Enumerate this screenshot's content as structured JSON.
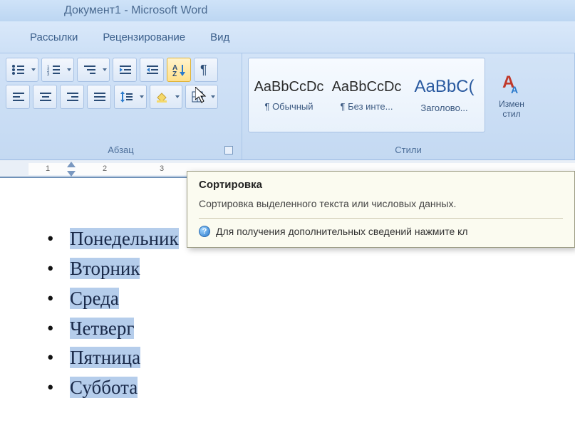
{
  "title": "Документ1 - Microsoft Word",
  "tabs": {
    "mailings": "Рассылки",
    "review": "Рецензирование",
    "view": "Вид"
  },
  "paragraph": {
    "label": "Абзац",
    "buttons": {
      "bullets": "bullets",
      "numbering": "numbering",
      "multilevel": "multilevel",
      "dec_indent": "decrease-indent",
      "inc_indent": "increase-indent",
      "sort": "sort",
      "marks": "show-marks",
      "align_left": "align-left",
      "align_center": "align-center",
      "align_right": "align-right",
      "justify": "justify",
      "line_spacing": "line-spacing",
      "shading": "shading",
      "borders": "borders"
    }
  },
  "styles": {
    "label": "Стили",
    "change_label_1": "Измен",
    "change_label_2": "стил",
    "items": [
      {
        "preview": "AaBbCcDc",
        "name": "¶ Обычный"
      },
      {
        "preview": "AaBbCcDc",
        "name": "¶ Без инте..."
      },
      {
        "preview": "AaBbC(",
        "name": "Заголово..."
      }
    ]
  },
  "tooltip": {
    "title": "Сортировка",
    "body": "Сортировка выделенного текста или числовых данных.",
    "help": "Для получения дополнительных сведений нажмите кл"
  },
  "ruler": {
    "nums": [
      "1",
      "2",
      "3"
    ]
  },
  "list_items": [
    "Понедельник",
    "Вторник",
    "Среда",
    "Четверг",
    "Пятница",
    "Суббота"
  ]
}
